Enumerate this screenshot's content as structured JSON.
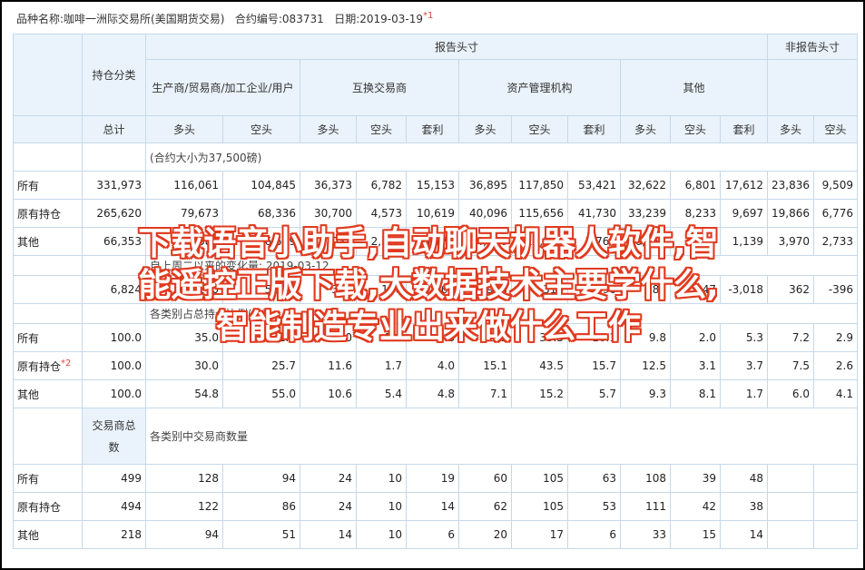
{
  "header": {
    "product_label": "品种名称:",
    "product_value": "咖啡一洲际交易所(美国期货交易)",
    "contract_label": "合约编号:",
    "contract_value": "083731",
    "date_label": "日期:",
    "date_value": "2019-03-19",
    "footnote_mark": "*1"
  },
  "table": {
    "group_reporting": "报告头寸",
    "group_nonreporting": "非报告头寸",
    "position_category": "持仓分类",
    "producer": "生产商/贸易商/加工企业/用户",
    "swap": "互换交易商",
    "managed": "资产管理机构",
    "other": "其他",
    "total": "总计",
    "long": "多头",
    "short": "空头",
    "spread": "套利",
    "contract_size_note": "(合约大小为37,500磅)",
    "change_note": "自上周二以来的变化量: 2019-03-12",
    "percent_note": "各类别占总持仓比例(%)",
    "trader_count_label": "交易商总数",
    "trader_count_note": "各类别中交易商数量",
    "footnote_mark_2": "*2",
    "rows_positions": [
      {
        "label": "所有",
        "cells": [
          "331,973",
          "116,061",
          "104,845",
          "36,373",
          "6,782",
          "15,153",
          "36,895",
          "117,850",
          "53,421",
          "32,622",
          "6,801",
          "17,612",
          "23,836",
          "9,509"
        ]
      },
      {
        "label": "原有持仓",
        "cells": [
          "265,620",
          "79,673",
          "68,336",
          "30,700",
          "4,573",
          "10,619",
          "40,096",
          "115,656",
          "41,730",
          "33,239",
          "8,233",
          "9,697",
          "19,866",
          "6,776"
        ]
      },
      {
        "label": "其他",
        "cells": [
          "66,353",
          "36,388",
          "36,509",
          "7,031",
          "2,578",
          "3,178",
          "4,170",
          "11,116",
          "2,769",
          "6,151",
          "3,140",
          "1,139",
          "3,970",
          "2,733"
        ]
      }
    ],
    "rows_change": [
      {
        "label": "",
        "cells": [
          "6,824",
          "1,270",
          "5,284",
          "397",
          "120",
          "1,861",
          "905",
          "316",
          "5,090",
          "381",
          "2,147",
          "-3,018",
          "362",
          "-396"
        ]
      }
    ],
    "rows_percent": [
      {
        "label": "所有",
        "cells": [
          "100.0",
          "35.0",
          "31.6",
          "11.0",
          "2.0",
          "4.6",
          "11.1",
          "35.5",
          "16.1",
          "9.8",
          "2.0",
          "5.3",
          "7.2",
          "2.9"
        ]
      },
      {
        "label": "原有持仓",
        "cells": [
          "100.0",
          "30.0",
          "25.7",
          "11.6",
          "1.7",
          "4.0",
          "15.1",
          "43.5",
          "15.7",
          "12.5",
          "3.1",
          "3.7",
          "7.5",
          "2.6"
        ]
      },
      {
        "label": "其他",
        "cells": [
          "100.0",
          "54.8",
          "55.0",
          "10.6",
          "5.4",
          "4.8",
          "7.1",
          "15.2",
          "5.7",
          "9.3",
          "8.1",
          "1.7",
          "6.0",
          "4.1"
        ]
      }
    ],
    "rows_traders": [
      {
        "label": "所有",
        "cells": [
          "499",
          "128",
          "94",
          "24",
          "10",
          "19",
          "60",
          "105",
          "63",
          "108",
          "39",
          "48",
          "",
          ""
        ]
      },
      {
        "label": "原有持仓",
        "cells": [
          "494",
          "122",
          "86",
          "24",
          "10",
          "14",
          "62",
          "105",
          "53",
          "111",
          "42",
          "38",
          "",
          ""
        ]
      },
      {
        "label": "其他",
        "cells": [
          "218",
          "94",
          "51",
          "14",
          "10",
          "6",
          "20",
          "17",
          "6",
          "33",
          "15",
          "14",
          "",
          ""
        ]
      }
    ]
  },
  "overlay": {
    "line1": "下载语音小助手,自动聊天机器人软件,智",
    "line2": "能遥控正版下载,大数据技术主要学什么,",
    "line3": "智能制造专业出来做什么工作"
  }
}
